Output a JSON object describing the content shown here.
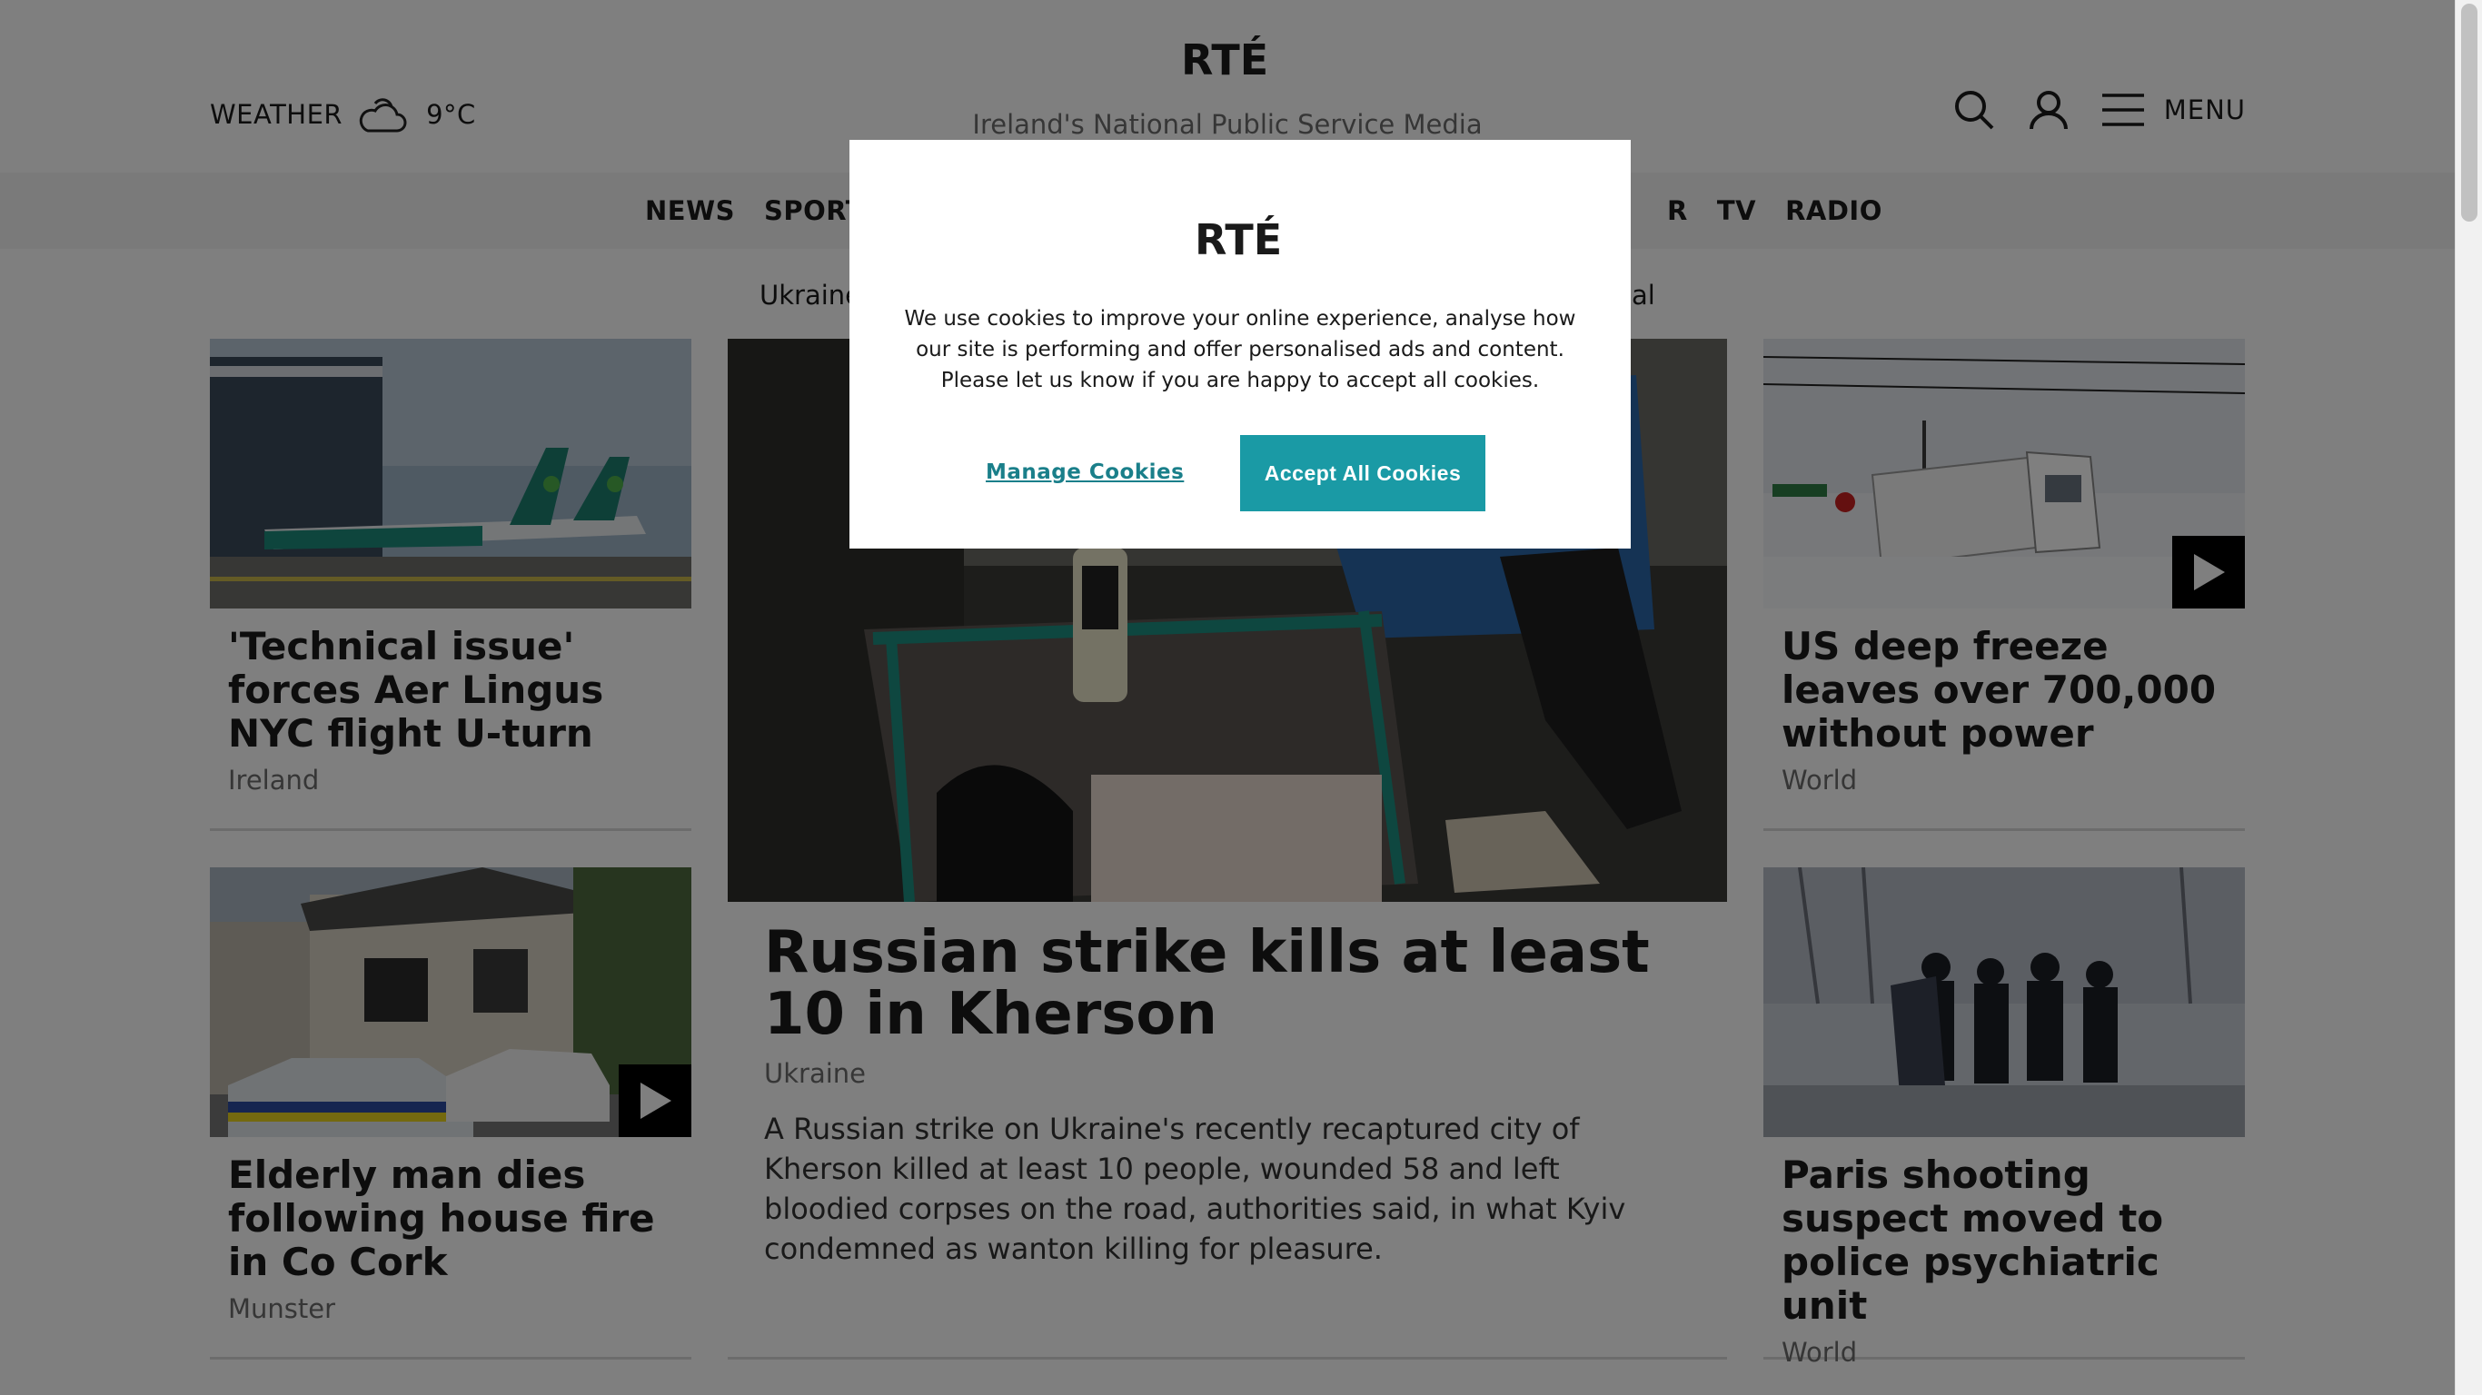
{
  "header": {
    "weather_label": "WEATHER",
    "weather_temp": "9°C",
    "logo_text": "RTÉ",
    "tagline": "Ireland's National Public Service Media",
    "menu_label": "MENU"
  },
  "nav": {
    "items_left": [
      "NEWS",
      "SPORT"
    ],
    "items_right": [
      "R",
      "TV",
      "RADIO"
    ]
  },
  "topics": {
    "first": "Ukraine",
    "last": "cal"
  },
  "articles": {
    "a1": {
      "title": "'Technical issue' forces Aer Lingus NYC flight U-turn",
      "section": "Ireland"
    },
    "a2": {
      "title": "Elderly man dies following house fire in Co Cork",
      "section": "Munster"
    },
    "lead": {
      "title": "Russian strike kills at least 10 in Kherson",
      "section": "Ukraine",
      "summary": "A Russian strike on Ukraine's recently recaptured city of Kherson killed at least 10 people, wounded 58 and left bloodied corpses on the road, authorities said, in what Kyiv condemned as wanton killing for pleasure."
    },
    "a3": {
      "title": "US deep freeze leaves over 700,000 without power",
      "section": "World"
    },
    "a4": {
      "title": "Paris shooting suspect moved to police psychiatric unit",
      "section": "World"
    }
  },
  "cookie_modal": {
    "logo_text": "RTÉ",
    "message": "We use cookies to improve your online experience, analyse how our site is performing and offer personalised ads and content. Please let us know if you are happy to accept all cookies.",
    "manage_label": "Manage Cookies",
    "accept_label": "Accept All Cookies"
  },
  "colors": {
    "accent": "#1a9aa5",
    "overlay": "rgba(0,0,0,0.5)"
  },
  "icons": [
    "partly-cloudy-icon",
    "search-icon",
    "user-icon",
    "hamburger-icon",
    "play-icon"
  ]
}
